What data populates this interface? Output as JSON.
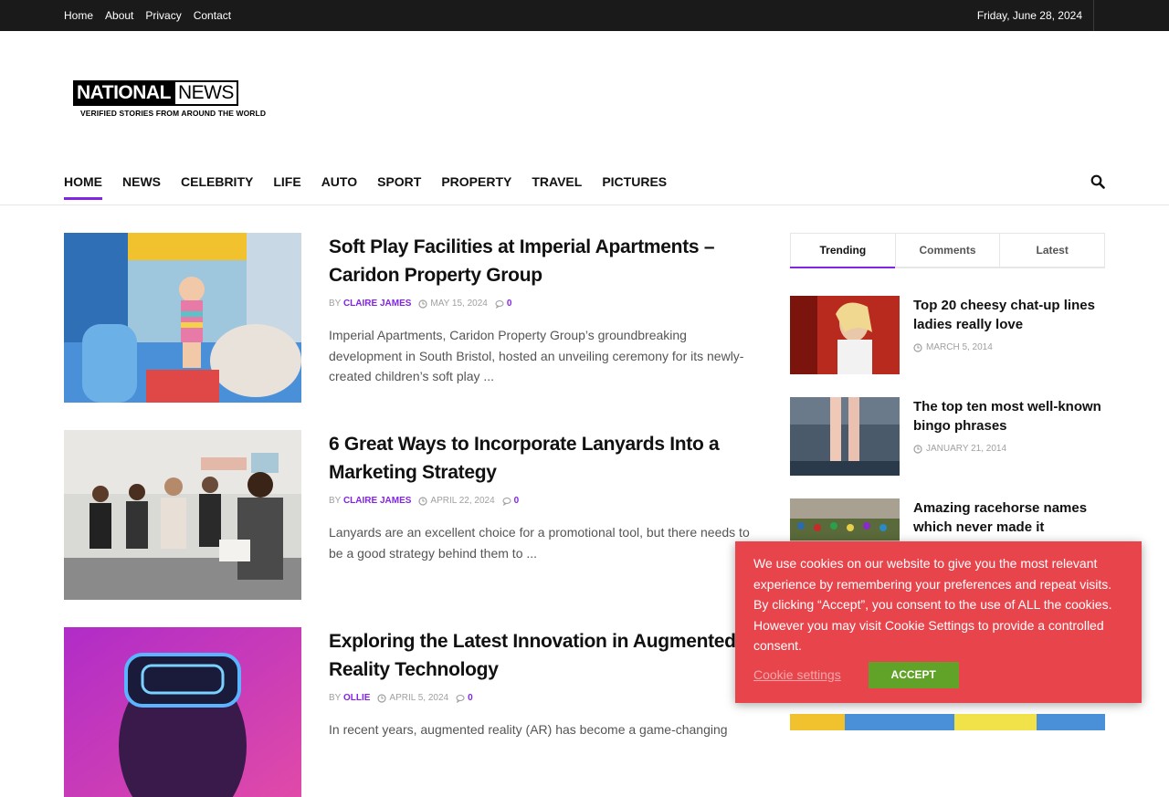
{
  "topbar": {
    "links": [
      "Home",
      "About",
      "Privacy",
      "Contact"
    ],
    "date": "Friday, June 28, 2024"
  },
  "logo": {
    "word1": "NATIONAL",
    "word2": "NEWS",
    "tagline": "VERIFIED STORIES FROM AROUND THE WORLD"
  },
  "nav": {
    "items": [
      "HOME",
      "NEWS",
      "CELEBRITY",
      "LIFE",
      "AUTO",
      "SPORT",
      "PROPERTY",
      "TRAVEL",
      "PICTURES"
    ],
    "active": "HOME",
    "search_icon": "search-icon"
  },
  "articles": [
    {
      "title": "Soft Play Facilities at Imperial Apartments – Caridon Property Group",
      "by": "BY",
      "author": "CLAIRE JAMES",
      "date": "MAY 15, 2024",
      "comments": "0",
      "excerpt": "Imperial Apartments, Caridon Property Group’s groundbreaking development in South Bristol, hosted an unveiling ceremony for its newly-created children’s soft play ..."
    },
    {
      "title": "6 Great Ways to Incorporate Lanyards Into a Marketing Strategy",
      "by": "BY",
      "author": "CLAIRE JAMES",
      "date": "APRIL 22, 2024",
      "comments": "0",
      "excerpt": "Lanyards are an excellent choice for a promotional tool, but there needs to be a good strategy behind them to ..."
    },
    {
      "title": "Exploring the Latest Innovation in Augmented Reality Technology",
      "by": "BY",
      "author": "OLLIE",
      "date": "APRIL 5, 2024",
      "comments": "0",
      "excerpt": "In recent years, augmented reality (AR) has become a game-changing"
    }
  ],
  "sidebar": {
    "tabs": [
      "Trending",
      "Comments",
      "Latest"
    ],
    "active_tab": "Trending",
    "items": [
      {
        "title": "Top 20 cheesy chat-up lines ladies really love",
        "date": "MARCH 5, 2014"
      },
      {
        "title": "The top ten most well-known bingo phrases",
        "date": "JANUARY 21, 2014"
      },
      {
        "title": "Amazing racehorse names which never made it",
        "date": ""
      }
    ]
  },
  "cookie": {
    "text": "We use cookies on our website to give you the most relevant experience by remembering your preferences and repeat visits. By clicking “Accept”, you consent to the use of ALL the cookies. However you may visit Cookie Settings to provide a controlled consent.",
    "settings_label": "Cookie settings",
    "accept_label": "ACCEPT"
  },
  "colors": {
    "accent": "#8224e3",
    "topbar": "#1a1a1a",
    "cookie_bg": "#e8444c",
    "accept_bg": "#61a229"
  }
}
